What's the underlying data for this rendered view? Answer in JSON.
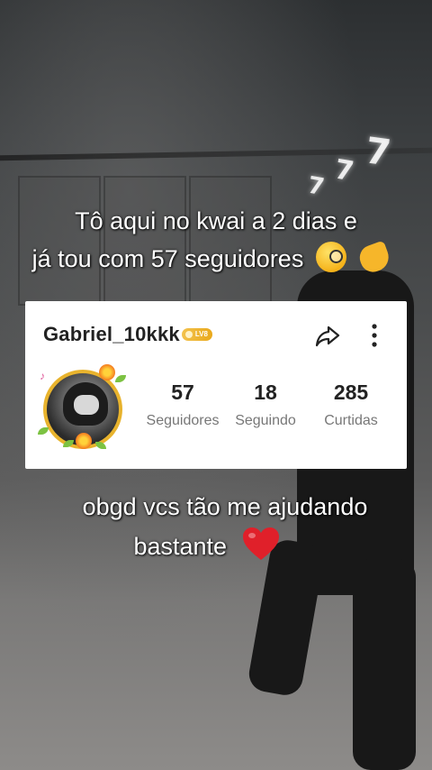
{
  "caption_top": {
    "line1": "Tô aqui no kwai a 2 dias e",
    "line2": "já tou com 57 seguidores"
  },
  "profile": {
    "username": "Gabriel_10kkk",
    "level_badge": "LV8",
    "stats": [
      {
        "value": "57",
        "label": "Seguidores"
      },
      {
        "value": "18",
        "label": "Seguindo"
      },
      {
        "value": "285",
        "label": "Curtidas"
      }
    ]
  },
  "caption_bottom": {
    "line1": "obgd vcs tão me ajudando",
    "line2": "bastante"
  },
  "icons": {
    "share": "share-icon",
    "more": "more-vertical-icon",
    "monocle_emoji": "face-with-monocle-emoji",
    "pointing_emoji": "backhand-pointing-left-emoji",
    "heart_emoji": "red-heart-emoji"
  },
  "colors": {
    "badge_gold": "#e9a91c",
    "avatar_ring": "#e8b32d",
    "heart_red": "#e0202a"
  }
}
